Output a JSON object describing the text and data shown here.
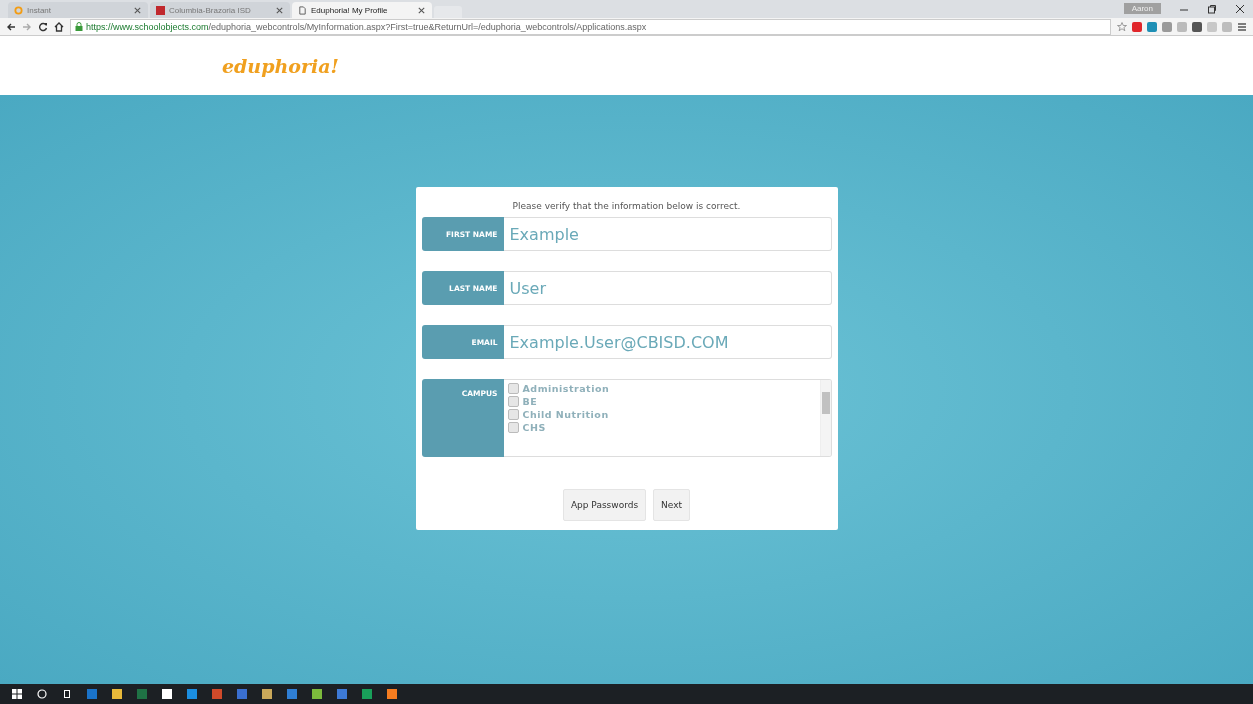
{
  "browser": {
    "tabs": [
      {
        "title": "Instant",
        "selected": false,
        "kind": "search"
      },
      {
        "title": "Columbia-Brazoria ISD",
        "selected": false,
        "kind": "red"
      },
      {
        "title": "Eduphoria! My Profile",
        "selected": true,
        "kind": "page"
      }
    ],
    "profile": "Aaron",
    "url_host": "https://www.schoolobjects.com",
    "url_path": "/eduphoria_webcontrols/MyInformation.aspx?First=true&ReturnUrl=/eduphoria_webcontrols/Applications.aspx"
  },
  "header": {
    "logo": "eduphoria!"
  },
  "form": {
    "intro": "Please verify that the information below is correct.",
    "fields": [
      {
        "label": "FIRST NAME",
        "value": "Example"
      },
      {
        "label": "LAST NAME",
        "value": "User"
      },
      {
        "label": "EMAIL",
        "value": "Example.User@CBISD.COM"
      }
    ],
    "campus": {
      "label": "CAMPUS",
      "options": [
        {
          "name": "Administration",
          "checked": false
        },
        {
          "name": "BE",
          "checked": false
        },
        {
          "name": "Child Nutrition",
          "checked": false
        },
        {
          "name": "CHS",
          "checked": false
        }
      ]
    },
    "buttons": [
      "App Passwords",
      "Next"
    ]
  }
}
